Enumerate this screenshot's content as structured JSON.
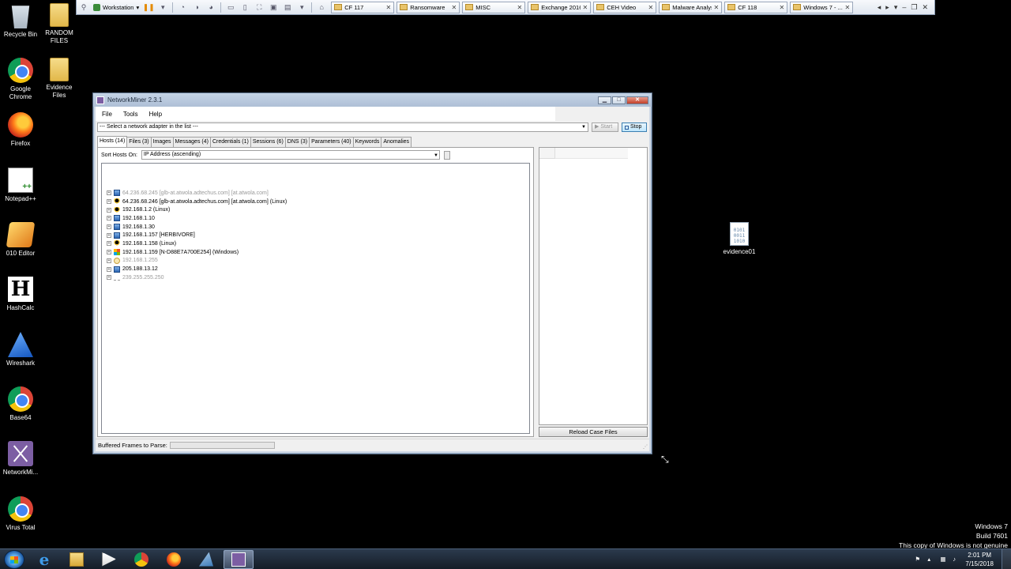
{
  "vmware": {
    "workstation_label": "Workstation",
    "tabs": [
      {
        "label": "CF 117"
      },
      {
        "label": "Ransomware"
      },
      {
        "label": "MISC"
      },
      {
        "label": "Exchange 2016"
      },
      {
        "label": "CEH Video"
      },
      {
        "label": "Malware Analysis"
      },
      {
        "label": "CF 118"
      },
      {
        "label": "Windows 7 - ..."
      }
    ]
  },
  "desktop": {
    "icons": [
      {
        "label": "Recycle Bin",
        "icon": "recycle-bin-icon"
      },
      {
        "label": "RANDOM FILES",
        "icon": "folder-icon"
      },
      {
        "label": "Google Chrome",
        "icon": "chrome-icon"
      },
      {
        "label": "Evidence Files",
        "icon": "folder-icon"
      },
      {
        "label": "Firefox",
        "icon": "firefox-icon"
      },
      {
        "label": "Notepad++",
        "icon": "notepad-plus-plus-icon"
      },
      {
        "label": "010 Editor",
        "icon": "010-editor-icon"
      },
      {
        "label": "HashCalc",
        "icon": "hashcalc-icon"
      },
      {
        "label": "Wireshark",
        "icon": "wireshark-icon"
      },
      {
        "label": "Base64",
        "icon": "chrome-icon"
      },
      {
        "label": "NetworkMi...",
        "icon": "networkminer-icon"
      },
      {
        "label": "Virus Total",
        "icon": "chrome-icon"
      },
      {
        "label": "evidence01",
        "icon": "binary-file-icon"
      }
    ]
  },
  "window": {
    "title": "NetworkMiner 2.3.1",
    "menu": [
      "File",
      "Tools",
      "Help"
    ],
    "adapter_placeholder": "--- Select a network adapter in the list ---",
    "start_label": "Start",
    "stop_label": "Stop",
    "tabs": [
      {
        "label": "Hosts (14)",
        "active": true
      },
      {
        "label": "Files (3)"
      },
      {
        "label": "Images"
      },
      {
        "label": "Messages (4)"
      },
      {
        "label": "Credentials (1)"
      },
      {
        "label": "Sessions (6)"
      },
      {
        "label": "DNS (3)"
      },
      {
        "label": "Parameters (40)"
      },
      {
        "label": "Keywords"
      },
      {
        "label": "Anomalies"
      }
    ],
    "sort_label": "Sort Hosts On:",
    "sort_value": "IP Address (ascending)",
    "hosts": [
      {
        "text": "64.236.68.245 [glb-at.atwola.adtechus.com] [at.atwola.com]",
        "icon": "generic-host-icon",
        "dim": true
      },
      {
        "text": "64.236.68.246 [glb-at.atwola.adtechus.com] [at.atwola.com] (Linux)",
        "icon": "linux-icon",
        "dim": false
      },
      {
        "text": "192.168.1.2 (Linux)",
        "icon": "linux-icon",
        "dim": false
      },
      {
        "text": "192.168.1.10",
        "icon": "computer-icon",
        "dim": false
      },
      {
        "text": "192.168.1.30",
        "icon": "computer-icon",
        "dim": false
      },
      {
        "text": "192.168.1.157 [HERBIVORE]",
        "icon": "computer-icon",
        "dim": false
      },
      {
        "text": "192.168.1.158 (Linux)",
        "icon": "linux-icon",
        "dim": false
      },
      {
        "text": "192.168.1.159 [N-D88E7A700E254] (Windows)",
        "icon": "windows-icon",
        "dim": false
      },
      {
        "text": "192.168.1.255",
        "icon": "broadcast-icon",
        "dim": true
      },
      {
        "text": "205.188.13.12",
        "icon": "computer-icon",
        "dim": false
      },
      {
        "text": "239.255.255.250",
        "icon": "multicast-icon",
        "dim": true
      }
    ],
    "reload_label": "Reload Case Files",
    "status_label": "Buffered Frames to Parse:",
    "buffer_progress": 0
  },
  "watermark": {
    "line1": "Windows 7",
    "line2": "Build 7601",
    "line3": "This copy of Windows is not genuine"
  },
  "taskbar": {
    "apps": [
      {
        "icon": "internet-explorer-icon"
      },
      {
        "icon": "windows-explorer-icon"
      },
      {
        "icon": "media-player-icon"
      },
      {
        "icon": "chrome-icon"
      },
      {
        "icon": "firefox-icon"
      },
      {
        "icon": "wireshark-icon"
      },
      {
        "icon": "networkminer-icon",
        "active": true
      }
    ],
    "time": "2:01 PM",
    "date": "7/15/2018"
  }
}
